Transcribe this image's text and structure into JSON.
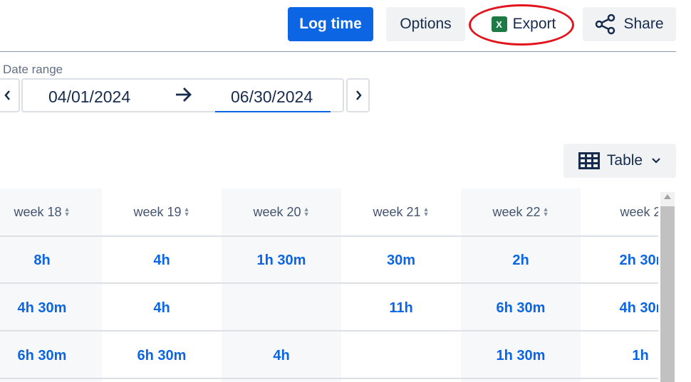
{
  "toolbar": {
    "log_time": "Log time",
    "options": "Options",
    "export": "Export",
    "export_icon": "X",
    "share": "Share"
  },
  "date_range": {
    "label": "Date range",
    "start": "04/01/2024",
    "end": "06/30/2024"
  },
  "view": {
    "label": "Table"
  },
  "table": {
    "columns": [
      "week 18",
      "week 19",
      "week 20",
      "week 21",
      "week 22",
      "week 2"
    ],
    "rows": [
      [
        "8h",
        "4h",
        "1h 30m",
        "30m",
        "2h",
        "2h 30r"
      ],
      [
        "4h 30m",
        "4h",
        "",
        "11h",
        "6h 30m",
        "4h 30r"
      ],
      [
        "6h 30m",
        "6h 30m",
        "4h",
        "",
        "1h 30m",
        "1h"
      ]
    ]
  },
  "colors": {
    "accent": "#0c66e4",
    "highlight": "#e3131b",
    "excel": "#1d7a45"
  },
  "icons": {
    "excel": "excel-icon",
    "share": "share-icon",
    "prev": "chevron-left-icon",
    "next": "chevron-right-icon",
    "arrow": "arrow-right-icon",
    "table": "table-grid-icon",
    "dropdown": "chevron-down-icon"
  }
}
